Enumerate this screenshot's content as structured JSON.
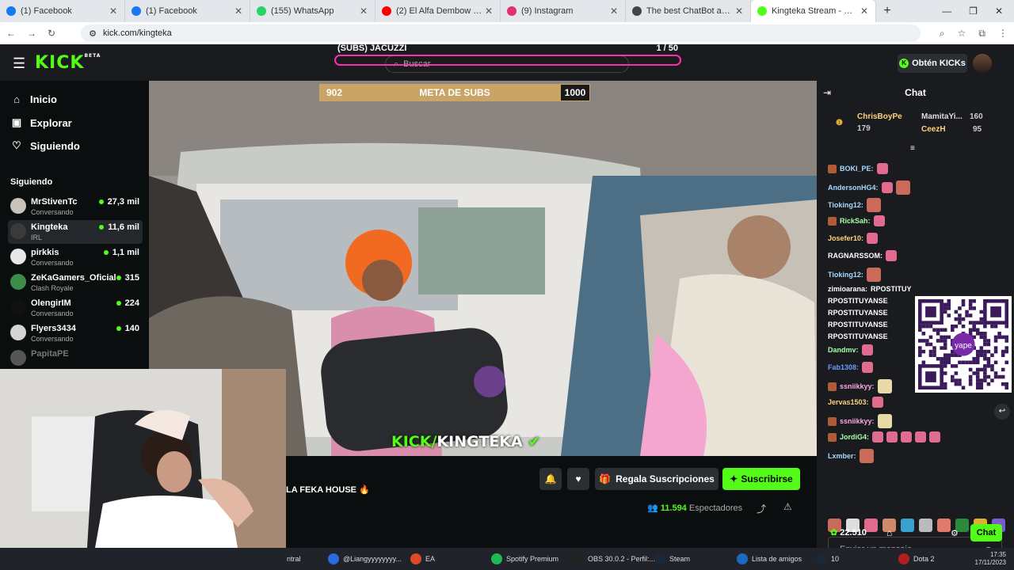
{
  "browser": {
    "tabs": [
      {
        "title": "(1) Facebook",
        "color": "#1877f2"
      },
      {
        "title": "(1) Facebook",
        "color": "#1877f2"
      },
      {
        "title": "(155) WhatsApp",
        "color": "#25d366"
      },
      {
        "title": "(2) El Alfa Dembow Mix 2022 -",
        "color": "#ff0000"
      },
      {
        "title": "(9) Instagram",
        "color": "#e1306c"
      },
      {
        "title": "The best ChatBot and Widgets",
        "color": "#444444"
      },
      {
        "title": "Kingteka Stream - Watch Li",
        "color": "#53fc18"
      }
    ],
    "url": "kick.com/kingteka"
  },
  "topnav": {
    "logo": "KICK",
    "logo_beta": "BETA",
    "search_placeholder": "Buscar",
    "obten_label": "Obtén KICKs"
  },
  "overlay": {
    "title": "(SUBS) JACUZZI",
    "count": "1 / 50"
  },
  "sidebar": {
    "nav": [
      {
        "label": "Inicio",
        "icon": "⌂"
      },
      {
        "label": "Explorar",
        "icon": "▣"
      },
      {
        "label": "Siguiendo",
        "icon": "♡"
      }
    ],
    "following_heading": "Siguiendo",
    "channels": [
      {
        "name": "MrStivenTc",
        "sub": "Conversando",
        "viewers": "27,3 mil"
      },
      {
        "name": "Kingteka",
        "sub": "IRL",
        "viewers": "11,6 mil"
      },
      {
        "name": "pirkkis",
        "sub": "Conversando",
        "viewers": "1,1 mil"
      },
      {
        "name": "ZeKaGamers_Oficial",
        "sub": "Clash Royale",
        "viewers": "315"
      },
      {
        "name": "OlengirIM",
        "sub": "Conversando",
        "viewers": "224"
      },
      {
        "name": "Flyers3434",
        "sub": "Conversando",
        "viewers": "140"
      }
    ],
    "offline_channel": "PapitaPE"
  },
  "stream": {
    "meta_left": "902",
    "meta_label": "META DE SUBS",
    "meta_right": "1000",
    "meta_progress": 0.902,
    "watermark_kick": "KICK/",
    "watermark_name": "KINGTEKA",
    "title": "LA FEKA HOUSE 🔥",
    "regala_label": "Regala Suscripciones",
    "subscribe_label": "Suscribirse",
    "viewers_count": "11.594",
    "viewers_label": "Espectadores"
  },
  "chat": {
    "title": "Chat",
    "gifters": [
      {
        "name": "ChrisBoyPe",
        "count": "179"
      },
      {
        "name": "MamitaYi...",
        "count": "160"
      },
      {
        "name": "CeezH",
        "count": "95"
      }
    ],
    "messages": [
      {
        "user": "BOKI_PE:",
        "color": "#a7d8ff",
        "text": ""
      },
      {
        "user": "AndersonHG4:",
        "color": "#a7d8ff",
        "text": ""
      },
      {
        "user": "Tioking12:",
        "color": "#a7d8ff",
        "text": ""
      },
      {
        "user": "RickSah:",
        "color": "#a7ffa7",
        "text": ""
      },
      {
        "user": "Josefer10:",
        "color": "#ffd27a",
        "text": ""
      },
      {
        "user": "RAGNARSSOM:",
        "color": "#ffffff",
        "text": ""
      },
      {
        "user": "Tioking12:",
        "color": "#a7d8ff",
        "text": ""
      },
      {
        "user": "zimioarana:",
        "color": "#ffffff",
        "text": "RPOSTITUY"
      },
      {
        "user": "",
        "color": "#ffffff",
        "text": "RPOSTITUYANSE"
      },
      {
        "user": "",
        "color": "#ffffff",
        "text": "RPOSTITUYANSE"
      },
      {
        "user": "",
        "color": "#ffffff",
        "text": "RPOSTITUYANSE"
      },
      {
        "user": "",
        "color": "#ffffff",
        "text": "RPOSTITUYANSE"
      },
      {
        "user": "Dandmv:",
        "color": "#a7ffa7",
        "text": ""
      },
      {
        "user": "Fab1308:",
        "color": "#6b9bff",
        "text": ""
      },
      {
        "user": "ssniikkyy:",
        "color": "#ffa7e0",
        "text": ""
      },
      {
        "user": "Jervas1503:",
        "color": "#ffd27a",
        "text": ""
      },
      {
        "user": "ssniikkyy:",
        "color": "#ffa7e0",
        "text": ""
      },
      {
        "user": "JordiG4:",
        "color": "#a7ffa7",
        "text": ""
      },
      {
        "user": "Lxmber:",
        "color": "#a7d8ff",
        "text": ""
      }
    ],
    "qr_label": "yape",
    "input_placeholder": "Enviar un mensaje",
    "points": "22.510",
    "send_label": "Chat"
  },
  "taskbar": {
    "items": [
      "ntral",
      "@Liangyyyyyyyy...",
      "EA",
      "Spotify Premium",
      "OBS 30.0.2 - Perfil:...",
      "Steam",
      "Lista de amigos",
      "10",
      "Dota 2"
    ],
    "time": "17:35",
    "date": "17/11/2023"
  }
}
